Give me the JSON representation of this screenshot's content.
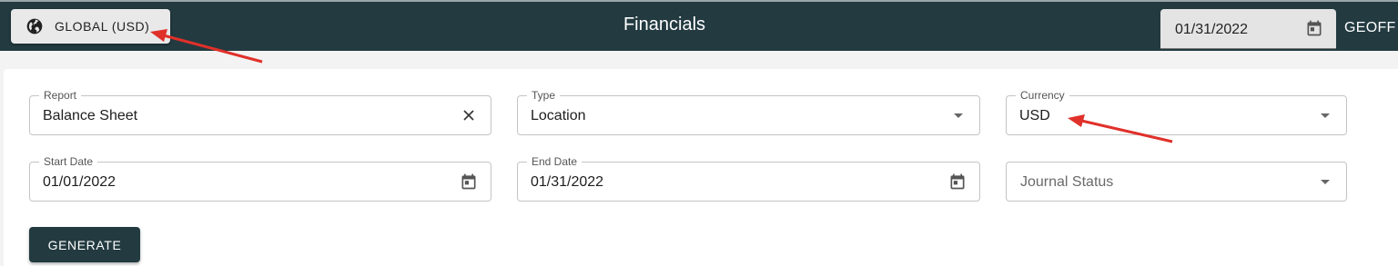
{
  "topbar": {
    "scope_button_label": "GLOBAL (USD)",
    "title": "Financials",
    "date_value": "01/31/2022",
    "user_label": "GEOFF"
  },
  "form": {
    "report": {
      "label": "Report",
      "value": "Balance Sheet"
    },
    "type": {
      "label": "Type",
      "value": "Location"
    },
    "currency": {
      "label": "Currency",
      "value": "USD"
    },
    "start_date": {
      "label": "Start Date",
      "value": "01/01/2022"
    },
    "end_date": {
      "label": "End Date",
      "value": "01/31/2022"
    },
    "journal_status": {
      "placeholder": "Journal Status"
    },
    "generate_label": "GENERATE"
  },
  "colors": {
    "topbar": "#223a40",
    "annotation_arrow": "#e0302a"
  },
  "icons": [
    "globe-icon",
    "calendar-icon",
    "clear-icon",
    "dropdown-arrow-icon"
  ]
}
